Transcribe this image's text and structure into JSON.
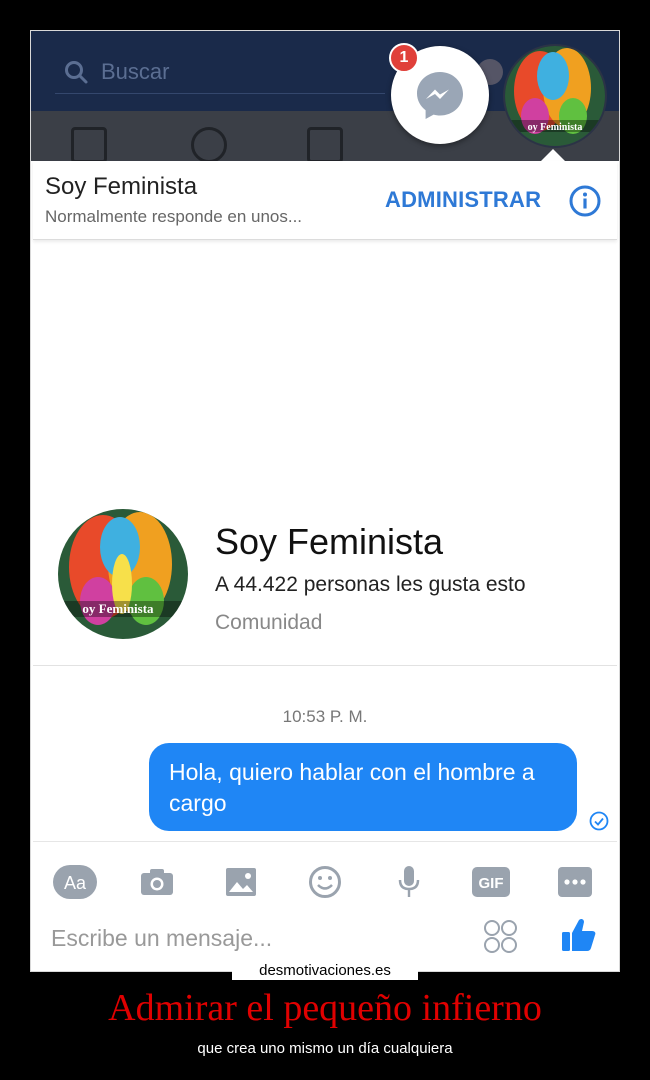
{
  "fb": {
    "search_placeholder": "Buscar",
    "notification_count": "1"
  },
  "panel": {
    "title": "Soy Feminista",
    "subtitle": "Normalmente responde en unos...",
    "admin_label": "ADMINISTRAR",
    "info_icon": "info-icon"
  },
  "profile": {
    "name": "Soy Feminista",
    "likes": "A 44.422 personas les gusta esto",
    "category": "Comunidad",
    "avatar_caption": "oy Feminista",
    "top_avatar_caption": "oy Feminista"
  },
  "conversation": {
    "timestamp": "10:53 P. M.",
    "message": "Hola, quiero hablar con el hombre a cargo"
  },
  "toolbar": {
    "aa_label": "Aa",
    "gif_label": "GIF",
    "items": [
      "text-format-icon",
      "camera-icon",
      "image-icon",
      "emoji-icon",
      "microphone-icon",
      "gif-icon",
      "more-icon"
    ]
  },
  "composer": {
    "placeholder": "Escribe un mensaje..."
  },
  "footer": {
    "site": "desmotivaciones.es",
    "headline": "Admirar el pequeño infierno",
    "subline": "que crea uno mismo un día cualquiera"
  },
  "colors": {
    "messenger_blue": "#1f86f5",
    "admin_blue": "#2e79d6",
    "headline_red": "#e00000"
  }
}
